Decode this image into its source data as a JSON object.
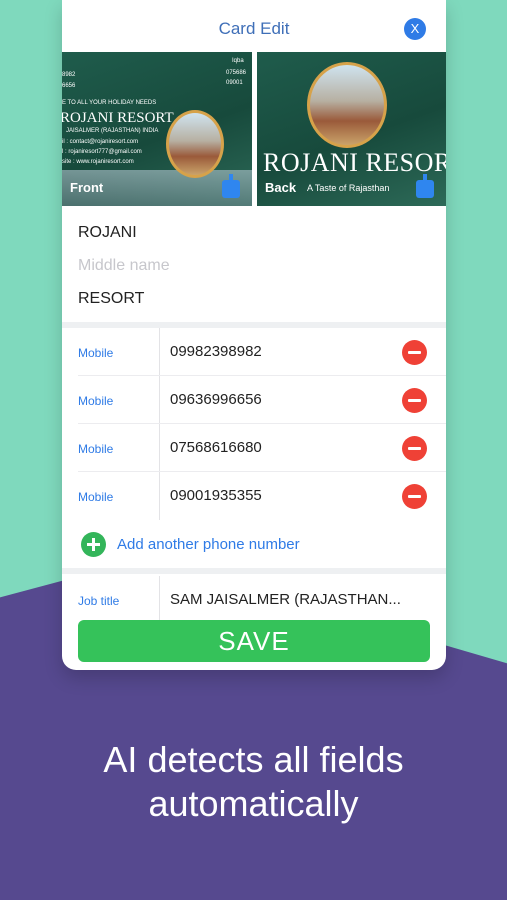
{
  "nav": {
    "title": "Card Edit",
    "close_label": "X"
  },
  "cards": {
    "front": {
      "label": "Front",
      "brand": "ROJANI RESORT",
      "lines": [
        "8982",
        "6656",
        "E TO ALL YOUR HOLIDAY NEEDS",
        "JAISALMER (RAJASTHAN) INDIA",
        "il : contact@rojaniresort.com",
        "l : rojaniresort777@gmail.com",
        "site : www.rojaniresort.com",
        "Iqba",
        "075686",
        "09001"
      ]
    },
    "back": {
      "label": "Back",
      "brand": "ROJANI RESOR",
      "tagline": "A Taste of Rajasthan"
    }
  },
  "name": {
    "first": "ROJANI",
    "middle_placeholder": "Middle name",
    "last": "RESORT"
  },
  "phones": [
    {
      "label": "Mobile",
      "value": "09982398982"
    },
    {
      "label": "Mobile",
      "value": "09636996656"
    },
    {
      "label": "Mobile",
      "value": "07568616680"
    },
    {
      "label": "Mobile",
      "value": "09001935355"
    }
  ],
  "add_phone_label": "Add another phone number",
  "job": {
    "label": "Job title",
    "value": "SAM JAISALMER (RAJASTHAN..."
  },
  "save_label": "SAVE",
  "caption": {
    "line1": "AI detects all fields",
    "line2": "automatically"
  },
  "colors": {
    "accent": "#2f7be6",
    "save": "#35c25a",
    "remove": "#ef4136",
    "add": "#33b55a",
    "bg_mint": "#7fd9bd",
    "bg_purple": "#56498f"
  }
}
